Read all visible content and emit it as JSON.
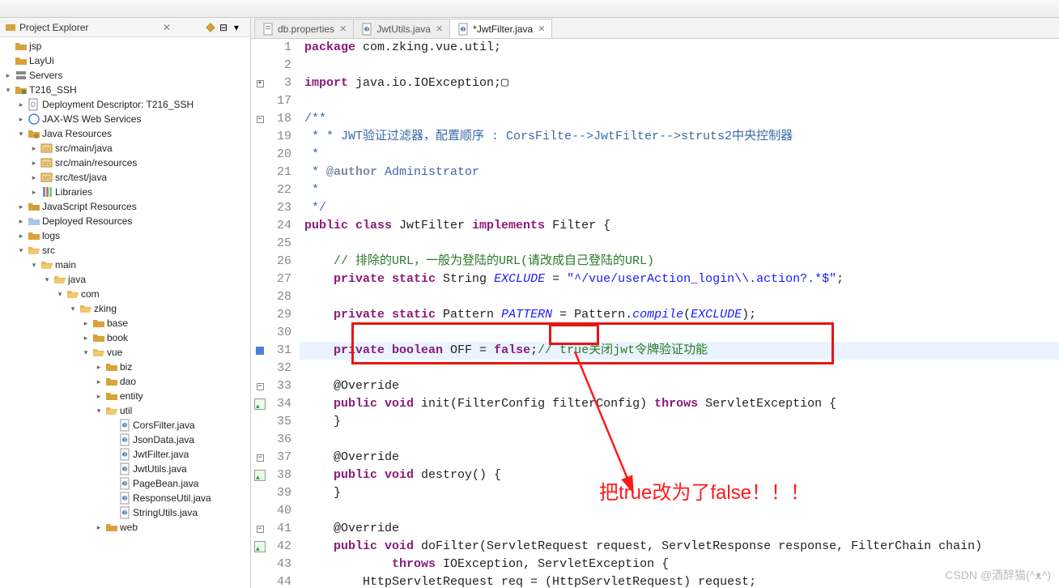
{
  "explorer": {
    "title": "Project Explorer",
    "nodes": [
      {
        "indent": 0,
        "twisty": "",
        "icon": "fld",
        "label": "jsp"
      },
      {
        "indent": 0,
        "twisty": "",
        "icon": "fld",
        "label": "LayUi"
      },
      {
        "indent": 0,
        "twisty": ">",
        "icon": "server",
        "label": "Servers"
      },
      {
        "indent": 0,
        "twisty": "v",
        "icon": "proj",
        "label": "T216_SSH"
      },
      {
        "indent": 1,
        "twisty": ">",
        "icon": "dd",
        "label": "Deployment Descriptor: T216_SSH"
      },
      {
        "indent": 1,
        "twisty": ">",
        "icon": "ws",
        "label": "JAX-WS Web Services"
      },
      {
        "indent": 1,
        "twisty": "v",
        "icon": "jres",
        "label": "Java Resources"
      },
      {
        "indent": 2,
        "twisty": ">",
        "icon": "srcfld",
        "label": "src/main/java"
      },
      {
        "indent": 2,
        "twisty": ">",
        "icon": "srcfld",
        "label": "src/main/resources"
      },
      {
        "indent": 2,
        "twisty": ">",
        "icon": "srcfld",
        "label": "src/test/java"
      },
      {
        "indent": 2,
        "twisty": ">",
        "icon": "lib",
        "label": "Libraries"
      },
      {
        "indent": 1,
        "twisty": ">",
        "icon": "jsres",
        "label": "JavaScript Resources"
      },
      {
        "indent": 1,
        "twisty": ">",
        "icon": "dep",
        "label": "Deployed Resources"
      },
      {
        "indent": 1,
        "twisty": ">",
        "icon": "fld",
        "label": "logs"
      },
      {
        "indent": 1,
        "twisty": "v",
        "icon": "fld-open",
        "label": "src"
      },
      {
        "indent": 2,
        "twisty": "v",
        "icon": "fld-open",
        "label": "main"
      },
      {
        "indent": 3,
        "twisty": "v",
        "icon": "fld-open",
        "label": "java"
      },
      {
        "indent": 4,
        "twisty": "v",
        "icon": "fld-open",
        "label": "com"
      },
      {
        "indent": 5,
        "twisty": "v",
        "icon": "fld-open",
        "label": "zking"
      },
      {
        "indent": 6,
        "twisty": ">",
        "icon": "fld",
        "label": "base"
      },
      {
        "indent": 6,
        "twisty": ">",
        "icon": "fld",
        "label": "book"
      },
      {
        "indent": 6,
        "twisty": "v",
        "icon": "fld-open",
        "label": "vue"
      },
      {
        "indent": 7,
        "twisty": ">",
        "icon": "fld",
        "label": "biz"
      },
      {
        "indent": 7,
        "twisty": ">",
        "icon": "fld",
        "label": "dao"
      },
      {
        "indent": 7,
        "twisty": ">",
        "icon": "fld",
        "label": "entity"
      },
      {
        "indent": 7,
        "twisty": "v",
        "icon": "fld-open",
        "label": "util"
      },
      {
        "indent": 8,
        "twisty": "",
        "icon": "jfile",
        "label": "CorsFilter.java"
      },
      {
        "indent": 8,
        "twisty": "",
        "icon": "jfile",
        "label": "JsonData.java"
      },
      {
        "indent": 8,
        "twisty": "",
        "icon": "jfile",
        "label": "JwtFilter.java"
      },
      {
        "indent": 8,
        "twisty": "",
        "icon": "jfile",
        "label": "JwtUtils.java"
      },
      {
        "indent": 8,
        "twisty": "",
        "icon": "jfile",
        "label": "PageBean.java"
      },
      {
        "indent": 8,
        "twisty": "",
        "icon": "jfile",
        "label": "ResponseUtil.java"
      },
      {
        "indent": 8,
        "twisty": "",
        "icon": "jfile",
        "label": "StringUtils.java"
      },
      {
        "indent": 7,
        "twisty": ">",
        "icon": "fld",
        "label": "web"
      }
    ]
  },
  "tabs": [
    {
      "icon": "props",
      "label": "db.properties",
      "active": false,
      "dirty": false
    },
    {
      "icon": "jfile",
      "label": "JwtUtils.java",
      "active": false,
      "dirty": false
    },
    {
      "icon": "jfile",
      "label": "*JwtFilter.java",
      "active": true,
      "dirty": true
    }
  ],
  "code": {
    "lines": [
      {
        "n": 1,
        "mk": "",
        "segs": [
          {
            "t": "package ",
            "c": "kw"
          },
          {
            "t": "com.zking.vue.util;"
          }
        ]
      },
      {
        "n": 2,
        "mk": "",
        "segs": []
      },
      {
        "n": 3,
        "mk": "+",
        "segs": [
          {
            "t": "import ",
            "c": "kw"
          },
          {
            "t": "java.io.IOException;▢"
          }
        ]
      },
      {
        "n": 17,
        "mk": "",
        "segs": []
      },
      {
        "n": 18,
        "mk": "-",
        "segs": [
          {
            "t": "/**",
            "c": "doc"
          }
        ]
      },
      {
        "n": 19,
        "mk": "",
        "segs": [
          {
            "t": " * * JWT验证过滤器，配置顺序 : CorsFilte-->JwtFilter-->struts2中央控制器",
            "c": "doc"
          }
        ]
      },
      {
        "n": 20,
        "mk": "",
        "segs": [
          {
            "t": " *",
            "c": "doc"
          }
        ]
      },
      {
        "n": 21,
        "mk": "",
        "segs": [
          {
            "t": " * ",
            "c": "doc"
          },
          {
            "t": "@author",
            "c": "doctag"
          },
          {
            "t": " Administrator",
            "c": "doc"
          }
        ]
      },
      {
        "n": 22,
        "mk": "",
        "segs": [
          {
            "t": " *",
            "c": "doc"
          }
        ]
      },
      {
        "n": 23,
        "mk": "",
        "segs": [
          {
            "t": " */",
            "c": "doc"
          }
        ]
      },
      {
        "n": 24,
        "mk": "",
        "segs": [
          {
            "t": "public class ",
            "c": "kw"
          },
          {
            "t": "JwtFilter "
          },
          {
            "t": "implements ",
            "c": "kw"
          },
          {
            "t": "Filter {"
          }
        ]
      },
      {
        "n": 25,
        "mk": "",
        "segs": []
      },
      {
        "n": 26,
        "mk": "",
        "segs": [
          {
            "t": "    "
          },
          {
            "t": "// 排除的URL，一般为登陆的URL(请改成自己登陆的URL)",
            "c": "cmt"
          }
        ]
      },
      {
        "n": 27,
        "mk": "",
        "segs": [
          {
            "t": "    "
          },
          {
            "t": "private static ",
            "c": "kw"
          },
          {
            "t": "String "
          },
          {
            "t": "EXCLUDE",
            "c": "ital"
          },
          {
            "t": " = "
          },
          {
            "t": "\"^/vue/userAction_login\\\\.action?.*$\"",
            "c": "str"
          },
          {
            "t": ";"
          }
        ]
      },
      {
        "n": 28,
        "mk": "",
        "segs": []
      },
      {
        "n": 29,
        "mk": "",
        "segs": [
          {
            "t": "    "
          },
          {
            "t": "private static ",
            "c": "kw"
          },
          {
            "t": "Pattern "
          },
          {
            "t": "PATTERN",
            "c": "ital"
          },
          {
            "t": " = Pattern."
          },
          {
            "t": "compile",
            "c": "ital"
          },
          {
            "t": "("
          },
          {
            "t": "EXCLUDE",
            "c": "ital"
          },
          {
            "t": ");"
          }
        ]
      },
      {
        "n": 30,
        "mk": "",
        "segs": []
      },
      {
        "n": 31,
        "mk": "blue",
        "hl": true,
        "segs": [
          {
            "t": "    "
          },
          {
            "t": "private boolean ",
            "c": "kw"
          },
          {
            "t": "OFF = "
          },
          {
            "t": "false",
            "c": "kw"
          },
          {
            "t": ";"
          },
          {
            "t": "// true关闭jwt令牌验证功能",
            "c": "cmt"
          }
        ]
      },
      {
        "n": 32,
        "mk": "",
        "segs": []
      },
      {
        "n": 33,
        "mk": "-",
        "segs": [
          {
            "t": "    @Override"
          }
        ]
      },
      {
        "n": 34,
        "mk": "ovr",
        "segs": [
          {
            "t": "    "
          },
          {
            "t": "public void ",
            "c": "kw"
          },
          {
            "t": "init(FilterConfig filterConfig) "
          },
          {
            "t": "throws ",
            "c": "kw"
          },
          {
            "t": "ServletException {"
          }
        ]
      },
      {
        "n": 35,
        "mk": "",
        "segs": [
          {
            "t": "    }"
          }
        ]
      },
      {
        "n": 36,
        "mk": "",
        "segs": []
      },
      {
        "n": 37,
        "mk": "-",
        "segs": [
          {
            "t": "    @Override"
          }
        ]
      },
      {
        "n": 38,
        "mk": "ovr",
        "segs": [
          {
            "t": "    "
          },
          {
            "t": "public void ",
            "c": "kw"
          },
          {
            "t": "destroy() {"
          }
        ]
      },
      {
        "n": 39,
        "mk": "",
        "segs": [
          {
            "t": "    }"
          }
        ]
      },
      {
        "n": 40,
        "mk": "",
        "segs": []
      },
      {
        "n": 41,
        "mk": "-",
        "segs": [
          {
            "t": "    @Override"
          }
        ]
      },
      {
        "n": 42,
        "mk": "ovr",
        "segs": [
          {
            "t": "    "
          },
          {
            "t": "public void ",
            "c": "kw"
          },
          {
            "t": "doFilter(ServletRequest request, ServletResponse response, FilterChain chain)"
          }
        ]
      },
      {
        "n": 43,
        "mk": "",
        "segs": [
          {
            "t": "            "
          },
          {
            "t": "throws ",
            "c": "kw"
          },
          {
            "t": "IOException, ServletException {"
          }
        ]
      },
      {
        "n": 44,
        "mk": "",
        "segs": [
          {
            "t": "        HttpServletRequest req = (HttpServletRequest) request;"
          }
        ]
      }
    ]
  },
  "annotation": {
    "text": "把true改为了false！！！"
  },
  "watermark": "CSDN @酒醉猫(^ᴥ^)"
}
